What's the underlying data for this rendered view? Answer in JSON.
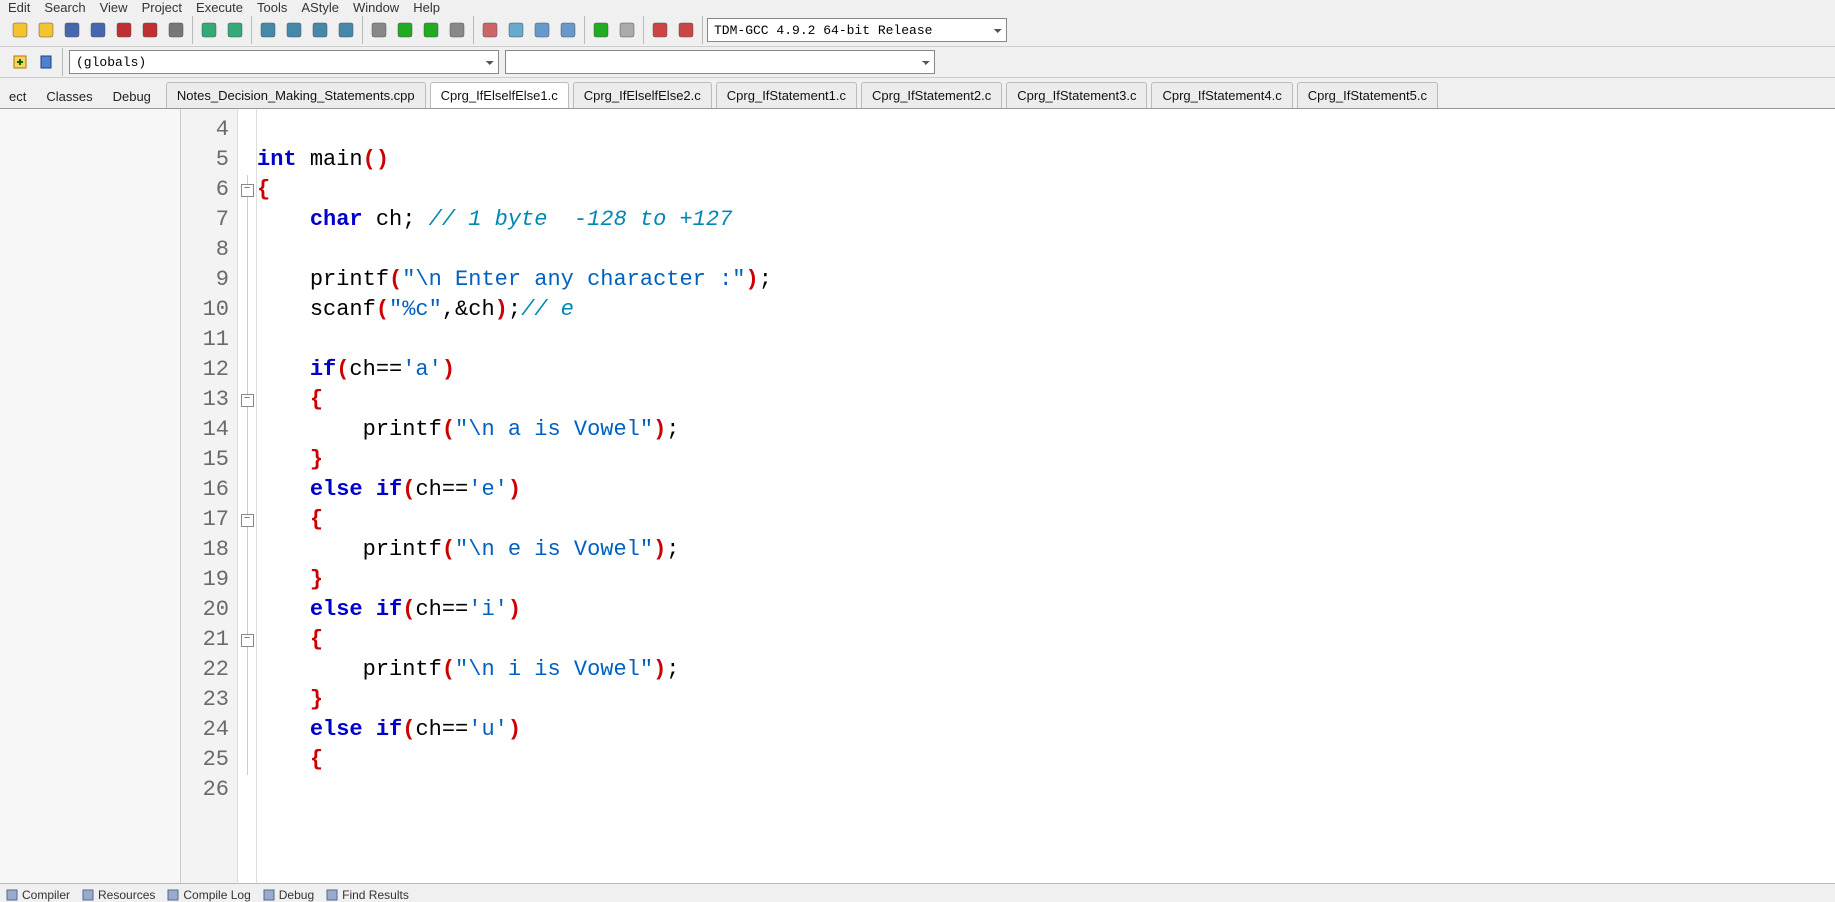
{
  "menu": {
    "items": [
      "Edit",
      "Search",
      "View",
      "Project",
      "Execute",
      "Tools",
      "AStyle",
      "Window",
      "Help"
    ]
  },
  "compiler": {
    "selected": "TDM-GCC 4.9.2 64-bit Release"
  },
  "scope": {
    "selected": "(globals)",
    "secondary": ""
  },
  "side_tabs": {
    "items": [
      "ect",
      "Classes",
      "Debug"
    ]
  },
  "file_tabs": {
    "items": [
      "Notes_Decision_Making_Statements.cpp",
      "Cprg_IfElselfElse1.c",
      "Cprg_IfElselfElse2.c",
      "Cprg_IfStatement1.c",
      "Cprg_IfStatement2.c",
      "Cprg_IfStatement3.c",
      "Cprg_IfStatement4.c",
      "Cprg_IfStatement5.c"
    ],
    "active_index": 1
  },
  "bottom_tabs": {
    "items": [
      "Compiler",
      "Resources",
      "Compile Log",
      "Debug",
      "Find Results"
    ]
  },
  "editor": {
    "first_line_no": 4,
    "fold": [
      "none",
      "none",
      "box",
      "line",
      "line",
      "line",
      "line",
      "line",
      "line",
      "box",
      "line",
      "line",
      "line",
      "box",
      "line",
      "line",
      "line",
      "box",
      "line",
      "line",
      "line",
      "line"
    ],
    "lines": [
      {
        "t": [
          [
            "",
            ""
          ]
        ]
      },
      {
        "t": [
          [
            "kw",
            "int"
          ],
          [
            "",
            " "
          ],
          [
            "fn",
            "main"
          ],
          [
            "pn",
            "()"
          ]
        ]
      },
      {
        "t": [
          [
            "br",
            "{"
          ]
        ]
      },
      {
        "t": [
          [
            "",
            "    "
          ],
          [
            "kw",
            "char"
          ],
          [
            "",
            " ch"
          ],
          [
            "op",
            ";"
          ],
          [
            "",
            " "
          ],
          [
            "cmt",
            "// 1 byte  -128 to +127"
          ]
        ]
      },
      {
        "t": [
          [
            "",
            ""
          ]
        ]
      },
      {
        "t": [
          [
            "",
            "    "
          ],
          [
            "fn",
            "printf"
          ],
          [
            "pn",
            "("
          ],
          [
            "str",
            "\"\\n Enter any character :\""
          ],
          [
            "pn",
            ")"
          ],
          [
            "op",
            ";"
          ]
        ]
      },
      {
        "t": [
          [
            "",
            "    "
          ],
          [
            "fn",
            "scanf"
          ],
          [
            "pn",
            "("
          ],
          [
            "str",
            "\"%c\""
          ],
          [
            "op",
            ","
          ],
          [
            "op",
            "&"
          ],
          [
            "",
            "ch"
          ],
          [
            "pn",
            ")"
          ],
          [
            "op",
            ";"
          ],
          [
            "cmt",
            "// e"
          ]
        ]
      },
      {
        "t": [
          [
            "",
            ""
          ]
        ]
      },
      {
        "t": [
          [
            "",
            "    "
          ],
          [
            "kw",
            "if"
          ],
          [
            "pn",
            "("
          ],
          [
            "",
            "ch"
          ],
          [
            "op",
            "=="
          ],
          [
            "str",
            "'a'"
          ],
          [
            "pn",
            ")"
          ]
        ]
      },
      {
        "t": [
          [
            "",
            "    "
          ],
          [
            "br",
            "{"
          ]
        ]
      },
      {
        "t": [
          [
            "",
            "        "
          ],
          [
            "fn",
            "printf"
          ],
          [
            "pn",
            "("
          ],
          [
            "str",
            "\"\\n a is Vowel\""
          ],
          [
            "pn",
            ")"
          ],
          [
            "op",
            ";"
          ]
        ]
      },
      {
        "t": [
          [
            "",
            "    "
          ],
          [
            "br",
            "}"
          ]
        ]
      },
      {
        "t": [
          [
            "",
            "    "
          ],
          [
            "kw",
            "else if"
          ],
          [
            "pn",
            "("
          ],
          [
            "",
            "ch"
          ],
          [
            "op",
            "=="
          ],
          [
            "str",
            "'e'"
          ],
          [
            "pn",
            ")"
          ]
        ]
      },
      {
        "t": [
          [
            "",
            "    "
          ],
          [
            "br",
            "{"
          ]
        ]
      },
      {
        "t": [
          [
            "",
            "        "
          ],
          [
            "fn",
            "printf"
          ],
          [
            "pn",
            "("
          ],
          [
            "str",
            "\"\\n e is Vowel\""
          ],
          [
            "pn",
            ")"
          ],
          [
            "op",
            ";"
          ]
        ]
      },
      {
        "t": [
          [
            "",
            "    "
          ],
          [
            "br",
            "}"
          ]
        ]
      },
      {
        "t": [
          [
            "",
            "    "
          ],
          [
            "kw",
            "else if"
          ],
          [
            "pn",
            "("
          ],
          [
            "",
            "ch"
          ],
          [
            "op",
            "=="
          ],
          [
            "str",
            "'i'"
          ],
          [
            "pn",
            ")"
          ]
        ]
      },
      {
        "t": [
          [
            "",
            "    "
          ],
          [
            "br",
            "{"
          ]
        ]
      },
      {
        "t": [
          [
            "",
            "        "
          ],
          [
            "fn",
            "printf"
          ],
          [
            "pn",
            "("
          ],
          [
            "str",
            "\"\\n i is Vowel\""
          ],
          [
            "pn",
            ")"
          ],
          [
            "op",
            ";"
          ]
        ]
      },
      {
        "t": [
          [
            "",
            "    "
          ],
          [
            "br",
            "}"
          ]
        ]
      },
      {
        "t": [
          [
            "",
            "    "
          ],
          [
            "kw",
            "else if"
          ],
          [
            "pn",
            "("
          ],
          [
            "",
            "ch"
          ],
          [
            "op",
            "=="
          ],
          [
            "str",
            "'u'"
          ],
          [
            "pn",
            ")"
          ]
        ]
      },
      {
        "t": [
          [
            "",
            "    "
          ],
          [
            "br",
            "{"
          ]
        ]
      }
    ]
  },
  "toolbar_icons": {
    "group1": [
      "new-file-icon",
      "open-file-icon",
      "save-icon",
      "save-all-icon",
      "close-icon",
      "close-all-icon",
      "print-icon"
    ],
    "group2": [
      "undo-icon",
      "redo-icon"
    ],
    "group3": [
      "find-icon",
      "replace-icon",
      "find-in-files-icon",
      "goto-line-icon"
    ],
    "group4": [
      "compile-icon",
      "run-icon",
      "compile-run-icon",
      "rebuild-all-icon"
    ],
    "group5": [
      "new-project-icon",
      "class-browser-icon",
      "toggle-bookmark-icon",
      "goto-bookmark-icon"
    ],
    "group6": [
      "check-icon",
      "stop-icon"
    ],
    "group7": [
      "chart-icon",
      "profile-icon"
    ]
  },
  "second_row_icons": [
    "insert-icon",
    "toggle-icon"
  ]
}
